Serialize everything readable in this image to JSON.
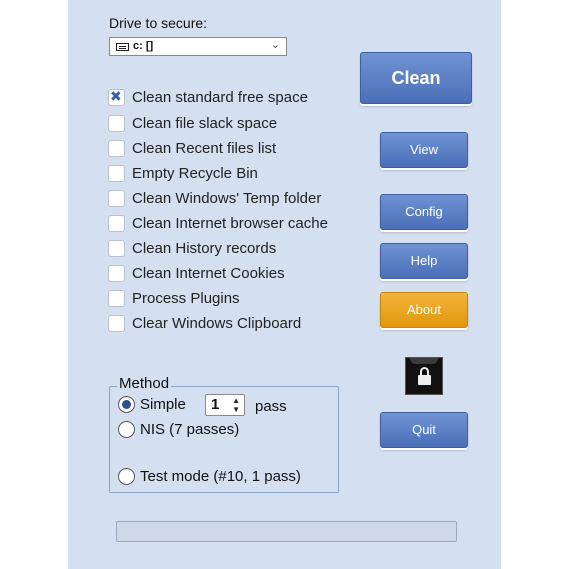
{
  "drive": {
    "label": "Drive to secure:",
    "selected": "c: []"
  },
  "options": [
    {
      "label": "Clean standard free space",
      "checked": true
    },
    {
      "label": "Clean file slack space",
      "checked": false
    },
    {
      "label": "Clean Recent  files list",
      "checked": false
    },
    {
      "label": "Empty Recycle Bin",
      "checked": false
    },
    {
      "label": "Clean Windows' Temp folder",
      "checked": false
    },
    {
      "label": "Clean Internet browser cache",
      "checked": false
    },
    {
      "label": "Clean History records",
      "checked": false
    },
    {
      "label": "Clean Internet Cookies",
      "checked": false
    },
    {
      "label": "Process Plugins",
      "checked": false
    },
    {
      "label": "Clear Windows Clipboard",
      "checked": false
    }
  ],
  "buttons": {
    "clean": "Clean",
    "view": "View",
    "config": "Config",
    "help": "Help",
    "about": "About",
    "quit": "Quit"
  },
  "method": {
    "title": "Method",
    "simple_label": "Simple",
    "passes_value": "1",
    "passes_suffix": "pass",
    "nis_label": "NIS (7 passes)",
    "test_label": "Test mode (#10, 1 pass)",
    "selected": "simple"
  },
  "progress": {
    "value": 0
  },
  "colors": {
    "panel": "#d4dff0",
    "button_blue": "#4a6fb7",
    "button_about": "#e0990e"
  },
  "icons": {
    "drive": "drive-icon",
    "dropdown": "chevron-down-icon",
    "lock": "lock-icon"
  }
}
